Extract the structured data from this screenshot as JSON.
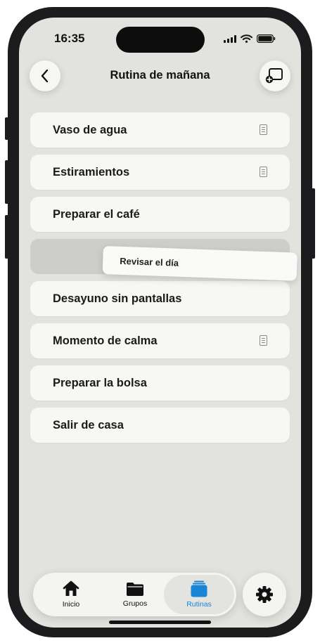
{
  "status_bar": {
    "time": "16:35"
  },
  "header": {
    "title": "Rutina de mañana",
    "back_icon": "chevron-left-icon",
    "action_icon": "add-cast-icon"
  },
  "routine_items": [
    {
      "label": "Vaso de agua",
      "has_note": true
    },
    {
      "label": "Estiramientos",
      "has_note": true
    },
    {
      "label": "Preparar el café",
      "has_note": false
    },
    {
      "label": "Desayuno sin pantallas",
      "has_note": false
    },
    {
      "label": "Momento de calma",
      "has_note": true
    },
    {
      "label": "Preparar la bolsa",
      "has_note": false
    },
    {
      "label": "Salir de casa",
      "has_note": false
    }
  ],
  "dragging_item": {
    "label": "Revisar el día"
  },
  "tab_bar": {
    "tabs": [
      {
        "label": "Inicio",
        "icon": "house-icon",
        "active": false
      },
      {
        "label": "Grupos",
        "icon": "folder-icon",
        "active": false
      },
      {
        "label": "Rutinas",
        "icon": "stack-icon",
        "active": true
      }
    ],
    "settings_icon": "gear-icon"
  },
  "colors": {
    "accent": "#1a84d6",
    "background": "#e2e2df",
    "card": "#f7f7f4"
  }
}
